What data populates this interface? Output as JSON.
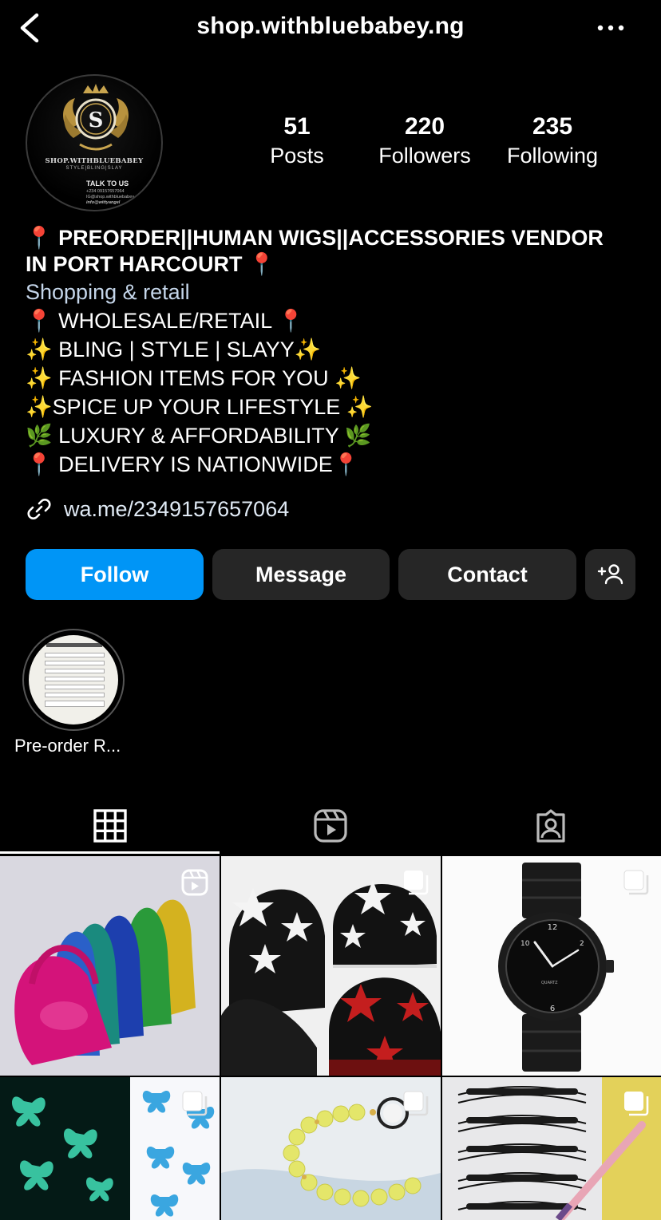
{
  "header": {
    "username": "shop.withbluebabey.ng",
    "back_icon": "chevron-left-icon",
    "more_icon": "ellipsis-icon"
  },
  "avatar": {
    "brand": "SHOP.WITHBLUEBABEY",
    "tagline": "STYLE|BLING|SLAY",
    "talk": "TALK TO US",
    "contact_line1": "+234 09157657064",
    "contact_line2": "IG@shop.withbluebabey",
    "contact_line3": "info@wittyangel"
  },
  "stats": [
    {
      "value": "51",
      "label": "Posts"
    },
    {
      "value": "220",
      "label": "Followers"
    },
    {
      "value": "235",
      "label": "Following"
    }
  ],
  "bio": {
    "name_line1": "📍 PREORDER||HUMAN WIGS||ACCESSORIES VENDOR",
    "name_line2": "IN PORT HARCOURT 📍",
    "category": "Shopping & retail",
    "lines": [
      "📍 WHOLESALE/RETAIL 📍",
      "✨ BLING | STYLE | SLAYY✨",
      "✨ FASHION ITEMS FOR YOU ✨",
      "✨SPICE UP YOUR LIFESTYLE ✨",
      "🌿 LUXURY & AFFORDABILITY 🌿",
      "📍 DELIVERY IS NATIONWIDE📍"
    ],
    "link": "wa.me/2349157657064"
  },
  "actions": {
    "follow": "Follow",
    "message": "Message",
    "contact": "Contact",
    "add_icon": "add-person-icon"
  },
  "highlight": {
    "label": "Pre-order R..."
  },
  "tabs": [
    {
      "name": "grid",
      "icon": "grid-icon",
      "active": true
    },
    {
      "name": "reels",
      "icon": "reels-icon",
      "active": false
    },
    {
      "name": "tagged",
      "icon": "tagged-icon",
      "active": false
    }
  ],
  "posts": [
    {
      "subject": "metallic handbags",
      "badge": "reel-icon"
    },
    {
      "subject": "star beanies",
      "badge": "carousel-icon"
    },
    {
      "subject": "black wristwatch",
      "badge": "carousel-icon"
    },
    {
      "subject": "glow butterflies",
      "badge": "carousel-icon"
    },
    {
      "subject": "beaded bracelet",
      "badge": "carousel-icon"
    },
    {
      "subject": "false eyelashes",
      "badge": "carousel-icon"
    }
  ],
  "colors": {
    "background": "#000000",
    "follow_button": "#0095f6",
    "secondary_button": "#262626",
    "category_text": "#c5d6ea"
  }
}
